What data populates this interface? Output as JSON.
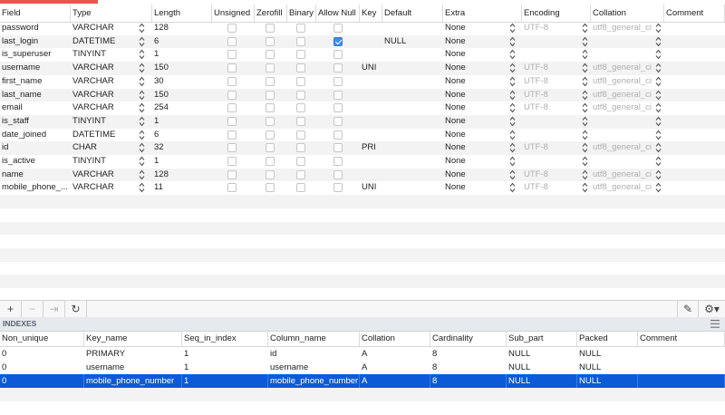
{
  "columns_header": [
    "Field",
    "Type",
    "Length",
    "Unsigned",
    "Zerofill",
    "Binary",
    "Allow Null",
    "Key",
    "Default",
    "Extra",
    "Encoding",
    "Collation",
    "Comment"
  ],
  "fields": [
    {
      "field": "password",
      "type": "VARCHAR",
      "length": "128",
      "allow_null": false,
      "key": "",
      "default": "",
      "extra": "None",
      "encoding": "UTF-8",
      "collation": "utf8_general_ci"
    },
    {
      "field": "last_login",
      "type": "DATETIME",
      "length": "6",
      "allow_null": true,
      "key": "",
      "default": "NULL",
      "extra": "None",
      "encoding": "",
      "collation": ""
    },
    {
      "field": "is_superuser",
      "type": "TINYINT",
      "length": "1",
      "allow_null": false,
      "key": "",
      "default": "",
      "extra": "None",
      "encoding": "",
      "collation": ""
    },
    {
      "field": "username",
      "type": "VARCHAR",
      "length": "150",
      "allow_null": false,
      "key": "UNI",
      "default": "",
      "extra": "None",
      "encoding": "UTF-8",
      "collation": "utf8_general_ci"
    },
    {
      "field": "first_name",
      "type": "VARCHAR",
      "length": "30",
      "allow_null": false,
      "key": "",
      "default": "",
      "extra": "None",
      "encoding": "UTF-8",
      "collation": "utf8_general_ci"
    },
    {
      "field": "last_name",
      "type": "VARCHAR",
      "length": "150",
      "allow_null": false,
      "key": "",
      "default": "",
      "extra": "None",
      "encoding": "UTF-8",
      "collation": "utf8_general_ci"
    },
    {
      "field": "email",
      "type": "VARCHAR",
      "length": "254",
      "allow_null": false,
      "key": "",
      "default": "",
      "extra": "None",
      "encoding": "UTF-8",
      "collation": "utf8_general_ci"
    },
    {
      "field": "is_staff",
      "type": "TINYINT",
      "length": "1",
      "allow_null": false,
      "key": "",
      "default": "",
      "extra": "None",
      "encoding": "",
      "collation": ""
    },
    {
      "field": "date_joined",
      "type": "DATETIME",
      "length": "6",
      "allow_null": false,
      "key": "",
      "default": "",
      "extra": "None",
      "encoding": "",
      "collation": ""
    },
    {
      "field": "id",
      "type": "CHAR",
      "length": "32",
      "allow_null": false,
      "key": "PRI",
      "default": "",
      "extra": "None",
      "encoding": "UTF-8",
      "collation": "utf8_general_ci"
    },
    {
      "field": "is_active",
      "type": "TINYINT",
      "length": "1",
      "allow_null": false,
      "key": "",
      "default": "",
      "extra": "None",
      "encoding": "",
      "collation": ""
    },
    {
      "field": "name",
      "type": "VARCHAR",
      "length": "128",
      "allow_null": false,
      "key": "",
      "default": "",
      "extra": "None",
      "encoding": "UTF-8",
      "collation": "utf8_general_ci"
    },
    {
      "field": "mobile_phone_...",
      "type": "VARCHAR",
      "length": "11",
      "allow_null": false,
      "key": "UNI",
      "default": "",
      "extra": "None",
      "encoding": "UTF-8",
      "collation": "utf8_general_ci"
    }
  ],
  "toolbar": {
    "add": "+",
    "remove": "−",
    "duplicate": "⇥",
    "refresh": "↻",
    "edit": "✎",
    "settings": "⚙▾"
  },
  "indexes": {
    "title": "INDEXES",
    "header": [
      "Non_unique",
      "Key_name",
      "Seq_in_index",
      "Column_name",
      "Collation",
      "Cardinality",
      "Sub_part",
      "Packed",
      "Comment"
    ],
    "rows": [
      {
        "non_unique": "0",
        "key_name": "PRIMARY",
        "seq": "1",
        "column": "id",
        "collation": "A",
        "cardinality": "8",
        "sub_part": "NULL",
        "packed": "NULL",
        "comment": "",
        "selected": false
      },
      {
        "non_unique": "0",
        "key_name": "username",
        "seq": "1",
        "column": "username",
        "collation": "A",
        "cardinality": "8",
        "sub_part": "NULL",
        "packed": "NULL",
        "comment": "",
        "selected": false
      },
      {
        "non_unique": "0",
        "key_name": "mobile_phone_number",
        "seq": "1",
        "column": "mobile_phone_number",
        "collation": "A",
        "cardinality": "8",
        "sub_part": "NULL",
        "packed": "NULL",
        "comment": "",
        "selected": true
      }
    ]
  },
  "colors": {
    "selection": "#0c5ad8",
    "accent_check": "#3b8df0",
    "tab_strip": "#e05a4e"
  }
}
